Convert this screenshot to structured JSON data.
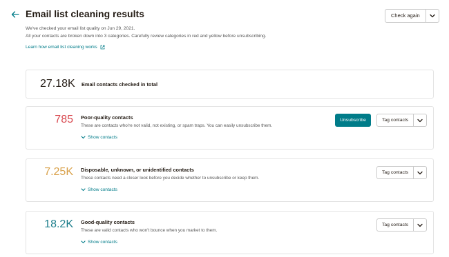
{
  "header": {
    "title": "Email list cleaning results",
    "check_again_label": "Check again",
    "back_icon": "arrow-left-icon"
  },
  "intro": {
    "line1": "We've checked your email list quality on Jun 29, 2021.",
    "line2": "All your contacts are broken down into 3 categories. Carefully review categories in red and yellow before unsubscribing.",
    "learn_link": "Learn how email list cleaning works"
  },
  "total": {
    "count": "27.18K",
    "label": "Email contacts checked in total"
  },
  "categories": [
    {
      "count": "785",
      "color": "#d94a51",
      "title": "Poor-quality contacts",
      "description": "These are contacts who're not valid, not existing, or spam traps. You can easily unsubscribe them.",
      "show_label": "Show contacts",
      "unsubscribe_label": "Unsubscribe",
      "tag_label": "Tag contacts"
    },
    {
      "count": "7.25K",
      "color": "#d9a14a",
      "title": "Disposable, unknown, or unidentified contacts",
      "description": "These contacts need a closer look before you decide whether to unsubscribe or keep them.",
      "show_label": "Show contacts",
      "tag_label": "Tag contacts"
    },
    {
      "count": "18.2K",
      "color": "#1e7f8c",
      "title": "Good-quality contacts",
      "description": "These are valid contacts who won't bounce when you market to them.",
      "show_label": "Show contacts",
      "tag_label": "Tag contacts"
    }
  ],
  "colors": {
    "accent": "#007c89",
    "text": "#241c15",
    "border": "#e3e3e3"
  }
}
